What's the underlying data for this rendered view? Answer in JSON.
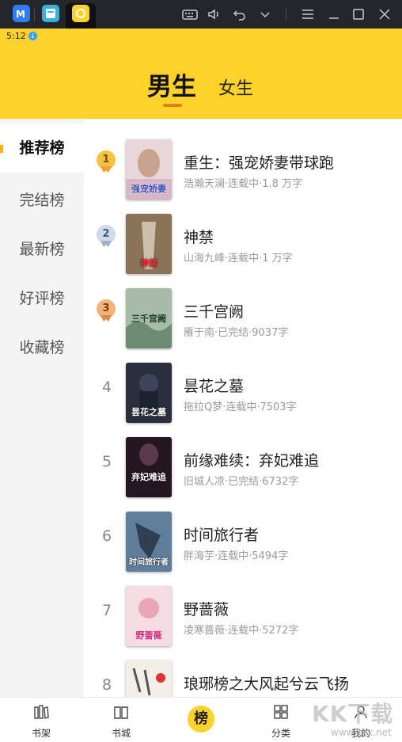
{
  "status_bar": {
    "time": "5:12"
  },
  "header": {
    "gender_tabs": [
      {
        "label": "男生"
      },
      {
        "label": "女生"
      }
    ]
  },
  "sidebar": {
    "items": [
      {
        "label": "推荐榜"
      },
      {
        "label": "完结榜"
      },
      {
        "label": "最新榜"
      },
      {
        "label": "好评榜"
      },
      {
        "label": "收藏榜"
      }
    ]
  },
  "ranking": [
    {
      "rank": "1",
      "title": "重生：强宠娇妻带球跑",
      "meta": "浩瀚天澜·连载中·1.8 万字",
      "cover_text": "强宠娇妻",
      "cover_color": "#e9d6d8"
    },
    {
      "rank": "2",
      "title": "神禁",
      "meta": "山海九峰·连载中·1 万字",
      "cover_text": "神禁",
      "cover_color": "#6b5a44"
    },
    {
      "rank": "3",
      "title": "三千宫阙",
      "meta": "雁于南·已完结·9037字",
      "cover_text": "三千宫阙",
      "cover_color": "#8fa892"
    },
    {
      "rank": "4",
      "title": "昙花之墓",
      "meta": "拖拉Q梦·连载中·7503字",
      "cover_text": "昙花之墓",
      "cover_color": "#2b2f3d"
    },
    {
      "rank": "5",
      "title": "前缘难续：弃妃难追",
      "meta": "旧城人凉·已完结·6732字",
      "cover_text": "弃妃难追",
      "cover_color": "#3a2230"
    },
    {
      "rank": "6",
      "title": "时间旅行者",
      "meta": "胖海芋·连载中·5494字",
      "cover_text": "时间旅行者",
      "cover_color": "#4d6a86"
    },
    {
      "rank": "7",
      "title": "野蔷薇",
      "meta": "凌寒蔷薇·连载中·5272字",
      "cover_text": "野蔷薇",
      "cover_color": "#f0c8d2"
    },
    {
      "rank": "8",
      "title": "琅琊榜之大风起兮云飞扬",
      "meta": "",
      "cover_text": "",
      "cover_color": "#f3eee6"
    }
  ],
  "bottom_nav": [
    {
      "label": "书架",
      "icon": "bookshelf-icon"
    },
    {
      "label": "书城",
      "icon": "book-icon"
    },
    {
      "label": "榜",
      "icon": "ranking-icon"
    },
    {
      "label": "分类",
      "icon": "grid-icon"
    },
    {
      "label": "我的",
      "icon": "user-icon"
    }
  ],
  "watermark": {
    "text": "KK下载",
    "sub": "www.kkx.net"
  },
  "colors": {
    "accent_yellow": "#fdd32b",
    "medal_gold": "#f5c242",
    "medal_silver": "#cfdbe8",
    "medal_bronze": "#f2b47a"
  }
}
